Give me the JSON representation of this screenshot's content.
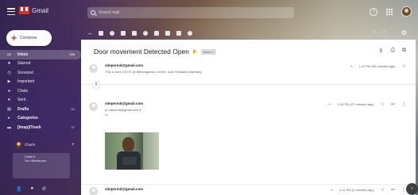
{
  "app": {
    "name": "Gmail"
  },
  "search": {
    "placeholder": "Search mail"
  },
  "compose": {
    "label": "Compose",
    "icon": "plus-icon"
  },
  "sidebar": {
    "items": [
      {
        "label": "Inbox",
        "count": "258",
        "icon": "inbox-icon"
      },
      {
        "label": "Starred",
        "icon": "star-icon"
      },
      {
        "label": "Snoozed",
        "icon": "clock-icon"
      },
      {
        "label": "Important",
        "icon": "important-icon"
      },
      {
        "label": "Chats",
        "icon": "chat-icon"
      },
      {
        "label": "Sent",
        "icon": "send-icon"
      },
      {
        "label": "Drafts",
        "count": "21",
        "icon": "draft-icon"
      },
      {
        "label": "Categories",
        "icon": "label-icon"
      },
      {
        "label": "[Imap]/Trash",
        "count": "37",
        "icon": "folder-icon"
      }
    ],
    "chats": {
      "label": "Charls",
      "preview": [
        "Charls K.",
        "You: Window pwr"
      ]
    }
  },
  "message": {
    "subject": "Door movement Detected Open",
    "label_chip": "Inbox ×",
    "first": {
      "sender": "sitepermit@gmail.com",
      "snippet": "This is from 145TS @ Miharagama,1 street, near Shakathi pharmacy",
      "time": "1:47 PM (56 minutes ago)"
    },
    "collapsed_count": "9",
    "second": {
      "sender": "sitepermit@gmail.com",
      "to": "to utarsena@gmail.com ▾",
      "ellipsis": "•••",
      "time": "2:16 PM (27 minutes ago)"
    },
    "third": {
      "sender": "sitepermit@gmail.com",
      "time": "2:41 PM (2 minutes ago)"
    }
  }
}
